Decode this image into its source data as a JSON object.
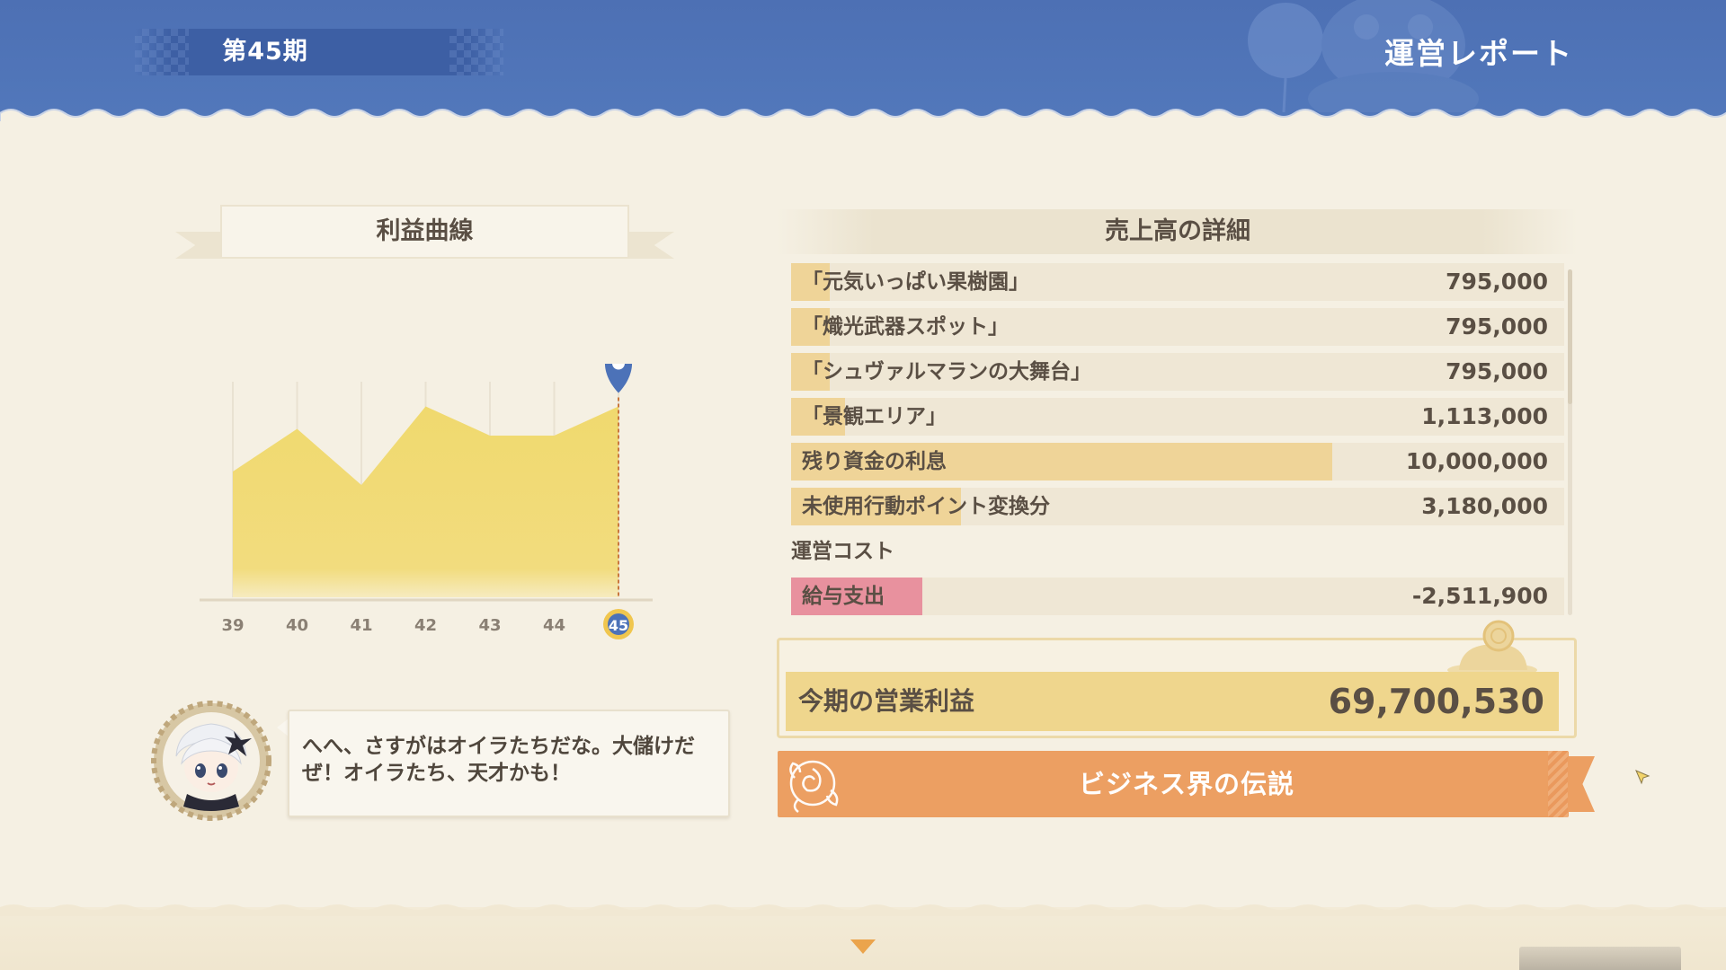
{
  "header": {
    "period": "第45期",
    "title": "運営レポート"
  },
  "profit_curve": {
    "title": "利益曲線"
  },
  "chart_data": {
    "type": "area",
    "x": [
      "39",
      "40",
      "41",
      "42",
      "43",
      "44",
      "45"
    ],
    "values": [
      0.56,
      0.75,
      0.5,
      0.85,
      0.72,
      0.72,
      0.85
    ],
    "ylim": [
      0,
      1
    ],
    "selected": "45",
    "grid": true,
    "color": "#f0d96e"
  },
  "dialogue": {
    "avatar_icon": "paimon-portrait-icon",
    "text_line1": "へへ、さすがはオイラたちだな。大儲けだ",
    "text_line2": "ぜ！オイラたち、天才かも！"
  },
  "sales_detail": {
    "title": "売上高の詳細",
    "rows": [
      {
        "label": "「元気いっぱい果樹園」",
        "value": "795,000",
        "fill": 0.05
      },
      {
        "label": "「熾光武器スポット」",
        "value": "795,000",
        "fill": 0.05
      },
      {
        "label": "「シュヴァルマランの大舞台」",
        "value": "795,000",
        "fill": 0.05
      },
      {
        "label": "「景観エリア」",
        "value": "1,113,000",
        "fill": 0.07
      },
      {
        "label": "残り資金の利息",
        "value": "10,000,000",
        "fill": 0.7
      },
      {
        "label": "未使用行動ポイント変換分",
        "value": "3,180,000",
        "fill": 0.22
      }
    ],
    "cost_heading": "運営コスト",
    "cost_rows": [
      {
        "label": "給与支出",
        "value": "-2,511,900",
        "fill": 0.17
      }
    ]
  },
  "operating_profit": {
    "label": "今期の営業利益",
    "value": "69,700,530"
  },
  "title_award": {
    "label": "ビジネス界の伝説",
    "icon": "rose-emblem-icon"
  },
  "colors": {
    "header_blue": "#5077b9",
    "bar_yellow": "#efd498",
    "cost_pink": "#e8919e",
    "banner_orange": "#ec9f62",
    "marker_blue": "#4c72b8"
  }
}
